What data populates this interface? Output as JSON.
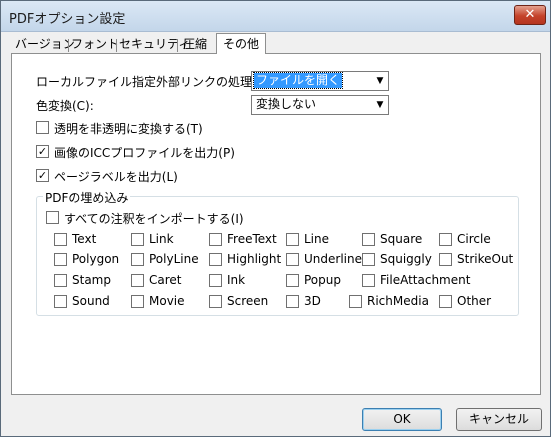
{
  "window": {
    "title": "PDFオプション設定",
    "close_glyph": "✕"
  },
  "tabs": [
    {
      "label": "バージョン"
    },
    {
      "label": "フォント"
    },
    {
      "label": "セキュリティ"
    },
    {
      "label": "圧縮"
    },
    {
      "label": "その他",
      "active": true
    }
  ],
  "settings": {
    "link_label": "ローカルファイル指定外部リンクの処理(E):",
    "link_value": "ファイルを開く",
    "color_label": "色変換(C):",
    "color_value": "変換しない",
    "transparency_label": "透明を非透明に変換する(T)",
    "transparency_checked": false,
    "icc_label": "画像のICCプロファイルを出力(P)",
    "icc_checked": true,
    "page_label_label": "ページラベルを出力(L)",
    "page_label_checked": true
  },
  "embed_group": {
    "title": "PDFの埋め込み",
    "import_all_label": "すべての注釈をインポートする(I)",
    "import_all_checked": false,
    "annotations": [
      [
        "Text",
        "Link",
        "FreeText",
        "Line",
        "Square",
        "Circle"
      ],
      [
        "Polygon",
        "PolyLine",
        "Highlight",
        "Underline",
        "Squiggly",
        "StrikeOut"
      ],
      [
        "Stamp",
        "Caret",
        "Ink",
        "Popup",
        "FileAttachment"
      ],
      [
        "Sound",
        "Movie",
        "Screen",
        "3D",
        "RichMedia",
        "Other"
      ]
    ]
  },
  "buttons": {
    "ok": "OK",
    "cancel": "キャンセル"
  }
}
